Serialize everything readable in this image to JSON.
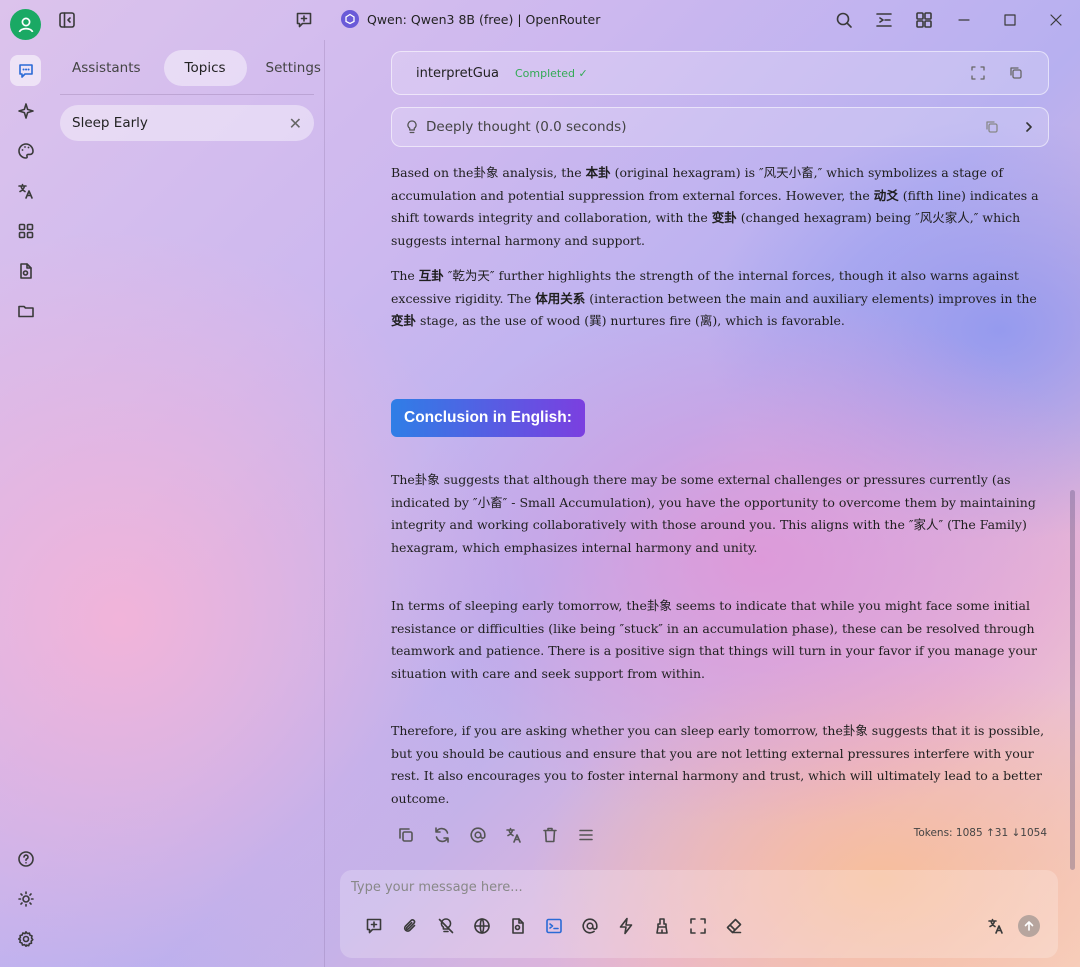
{
  "window": {
    "title": "Qwen: Qwen3 8B (free) | OpenRouter"
  },
  "sidebar": {
    "tabs": [
      {
        "label": "Assistants"
      },
      {
        "label": "Topics"
      },
      {
        "label": "Settings"
      }
    ],
    "active_tab": "Topics",
    "topics": [
      {
        "label": "Sleep Early"
      }
    ]
  },
  "rail": {
    "icons": [
      "chat-icon",
      "sparkle-icon",
      "palette-icon",
      "translate-icon",
      "apps-icon",
      "files-icon",
      "folder-icon",
      "help-icon",
      "theme-icon",
      "settings-icon"
    ]
  },
  "chat": {
    "tool_call": {
      "name": "interpretGua",
      "status": "Completed ✓"
    },
    "thinking": {
      "label": "Deeply thought (0.0 seconds)"
    },
    "para1": {
      "t1": "Based on the卦象 analysis, the ",
      "b1": "本卦",
      "t2": " (original hexagram) is ″风天小畜,″ which symbolizes a stage of accumulation and potential suppression from external forces. However, the ",
      "b2": "动爻",
      "t3": " (fifth line) indicates a shift towards integrity and collaboration, with the ",
      "b3": "变卦",
      "t4": " (changed hexagram) being ″风火家人,″ which suggests internal harmony and support."
    },
    "para2": {
      "t1": "The ",
      "b1": "互卦",
      "t2": " ″乾为天″ further highlights the strength of the internal forces, though it also warns against excessive rigidity. The ",
      "b2": "体用关系",
      "t3": " (interaction between the main and auxiliary elements) improves in the ",
      "b3": "变卦",
      "t4": " stage, as the use of wood (巽) nurtures fire (离), which is favorable."
    },
    "heading": "Conclusion in English:",
    "para3": "The卦象 suggests that although there may be some external challenges or pressures currently (as indicated by ″小畜″ - Small Accumulation), you have the opportunity to overcome them by maintaining integrity and working collaboratively with those around you. This aligns with the ″家人″ (The Family) hexagram, which emphasizes internal harmony and unity.",
    "para4": "In terms of sleeping early tomorrow, the卦象 seems to indicate that while you might face some initial resistance or difficulties (like being ″stuck″ in an accumulation phase), these can be resolved through teamwork and patience. There is a positive sign that things will turn in your favor if you manage your situation with care and seek support from within.",
    "para5": "Therefore, if you are asking whether you can sleep early tomorrow, the卦象 suggests that it is possible, but you should be cautious and ensure that you are not letting external pressures interfere with your rest. It also encourages you to foster internal harmony and trust, which will ultimately lead to a better outcome.",
    "tokens": "Tokens: 1085 ↑31 ↓1054"
  },
  "input": {
    "placeholder": "Type your message here..."
  },
  "colors": {
    "avatar": "#1aa964",
    "heading_start": "#2f7ee6",
    "heading_end": "#7b3fe0",
    "completed": "#33aa55"
  }
}
